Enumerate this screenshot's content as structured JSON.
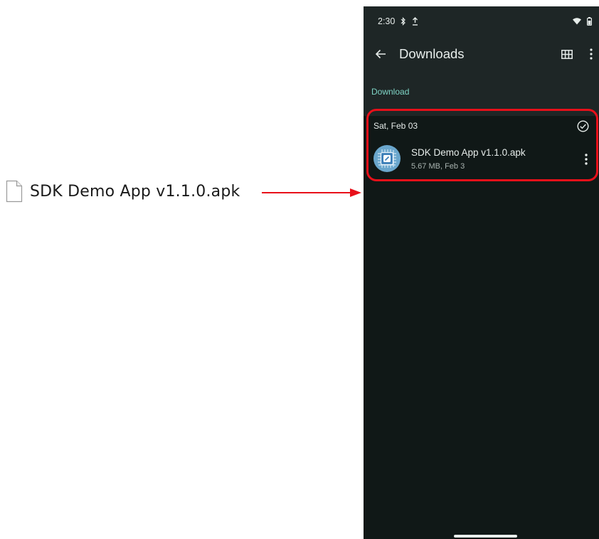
{
  "desktop": {
    "file_name": "SDK Demo App v1.1.0.apk",
    "icon": "file-icon"
  },
  "annotation": {
    "arrow_color": "#e8101a",
    "highlight_color": "#e8101a"
  },
  "phone": {
    "status_bar": {
      "time": "2:30",
      "icons": [
        "bluetooth-icon",
        "upload-icon",
        "wifi-icon",
        "battery-icon"
      ]
    },
    "toolbar": {
      "title": "Downloads",
      "back_icon": "arrow-back-icon",
      "view_icon": "grid-view-icon",
      "more_icon": "more-vert-icon"
    },
    "breadcrumb": "Download",
    "sections": [
      {
        "date": "Sat, Feb 03",
        "select_icon": "check-circle-icon",
        "files": [
          {
            "name": "SDK Demo App v1.1.0.apk",
            "meta": "5.67 MB, Feb 3",
            "icon": "apk-app-icon",
            "more_icon": "more-vert-icon"
          }
        ]
      }
    ],
    "colors": {
      "background": "#101817",
      "app_bar": "#1e2626",
      "accent": "#7fd5c6",
      "text": "#e6ecea",
      "secondary_text": "#a9b3b0"
    }
  }
}
